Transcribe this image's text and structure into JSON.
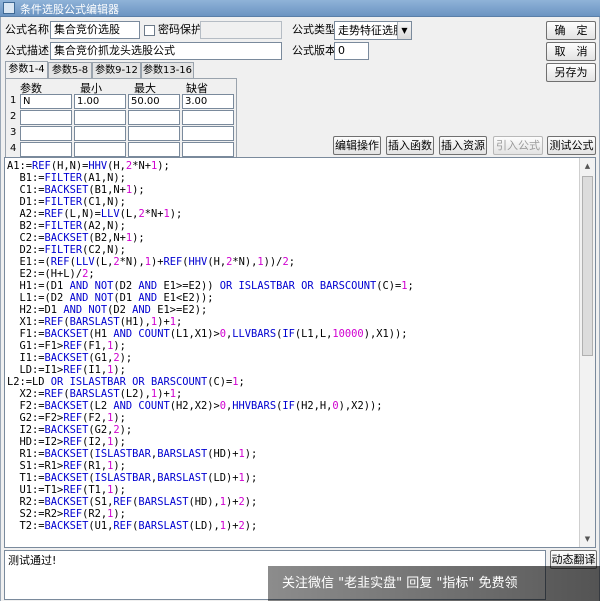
{
  "window": {
    "title": "条件选股公式编辑器"
  },
  "form": {
    "name_label": "公式名称",
    "name_value": "集合竞价选股",
    "password_label": "密码保护",
    "type_label": "公式类型",
    "type_value": "走势特征选股",
    "desc_label": "公式描述",
    "desc_value": "集合竞价抓龙头选股公式",
    "version_label": "公式版本",
    "version_value": "0"
  },
  "buttons": {
    "ok": "确　定",
    "cancel": "取　消",
    "save_as": "另存为",
    "edit_ops": "编辑操作",
    "insert_func": "插入函数",
    "insert_res": "插入资源",
    "import_formula": "引入公式",
    "test_formula": "测试公式",
    "dyn_translate": "动态翻译"
  },
  "tabs": [
    "参数1-4",
    "参数5-8",
    "参数9-12",
    "参数13-16"
  ],
  "params": {
    "headers": [
      "参数",
      "最小",
      "最大",
      "缺省"
    ],
    "rows": [
      {
        "num": "1",
        "name": "N",
        "min": "1.00",
        "max": "50.00",
        "default": "3.00"
      },
      {
        "num": "2",
        "name": "",
        "min": "",
        "max": "",
        "default": ""
      },
      {
        "num": "3",
        "name": "",
        "min": "",
        "max": "",
        "default": ""
      },
      {
        "num": "4",
        "name": "",
        "min": "",
        "max": "",
        "default": ""
      }
    ]
  },
  "status": {
    "message": "测试通过!"
  },
  "watermark": {
    "text": "关注微信 \"老韭实盘\" 回复 \"指标\" 免费领"
  },
  "code_lines": [
    "A1:=REF(H,N)=HHV(H,2*N+1);",
    "  B1:=FILTER(A1,N);",
    "  C1:=BACKSET(B1,N+1);",
    "  D1:=FILTER(C1,N);",
    "  A2:=REF(L,N)=LLV(L,2*N+1);",
    "  B2:=FILTER(A2,N);",
    "  C2:=BACKSET(B2,N+1);",
    "  D2:=FILTER(C2,N);",
    "  E1:=(REF(LLV(L,2*N),1)+REF(HHV(H,2*N),1))/2;",
    "  E2:=(H+L)/2;",
    "  H1:=(D1 AND NOT(D2 AND E1>=E2)) OR ISLASTBAR OR BARSCOUNT(C)=1;",
    "  L1:=(D2 AND NOT(D1 AND E1<E2));",
    "  H2:=D1 AND NOT(D2 AND E1>=E2);",
    "  X1:=REF(BARSLAST(H1),1)+1;",
    "  F1:=BACKSET(H1 AND COUNT(L1,X1)>0,LLVBARS(IF(L1,L,10000),X1));",
    "  G1:=F1>REF(F1,1);",
    "  I1:=BACKSET(G1,2);",
    "  LD:=I1>REF(I1,1);",
    "L2:=LD OR ISLASTBAR OR BARSCOUNT(C)=1;",
    "  X2:=REF(BARSLAST(L2),1)+1;",
    "  F2:=BACKSET(L2 AND COUNT(H2,X2)>0,HHVBARS(IF(H2,H,0),X2));",
    "  G2:=F2>REF(F2,1);",
    "  I2:=BACKSET(G2,2);",
    "  HD:=I2>REF(I2,1);",
    "  R1:=BACKSET(ISLASTBAR,BARSLAST(HD)+1);",
    "  S1:=R1>REF(R1,1);",
    "  T1:=BACKSET(ISLASTBAR,BARSLAST(LD)+1);",
    "  U1:=T1>REF(T1,1);",
    "  R2:=BACKSET(S1,REF(BARSLAST(HD),1)+2);",
    "  S2:=R2>REF(R2,1);",
    "  T2:=BACKSET(U1,REF(BARSLAST(LD),1)+2);"
  ]
}
